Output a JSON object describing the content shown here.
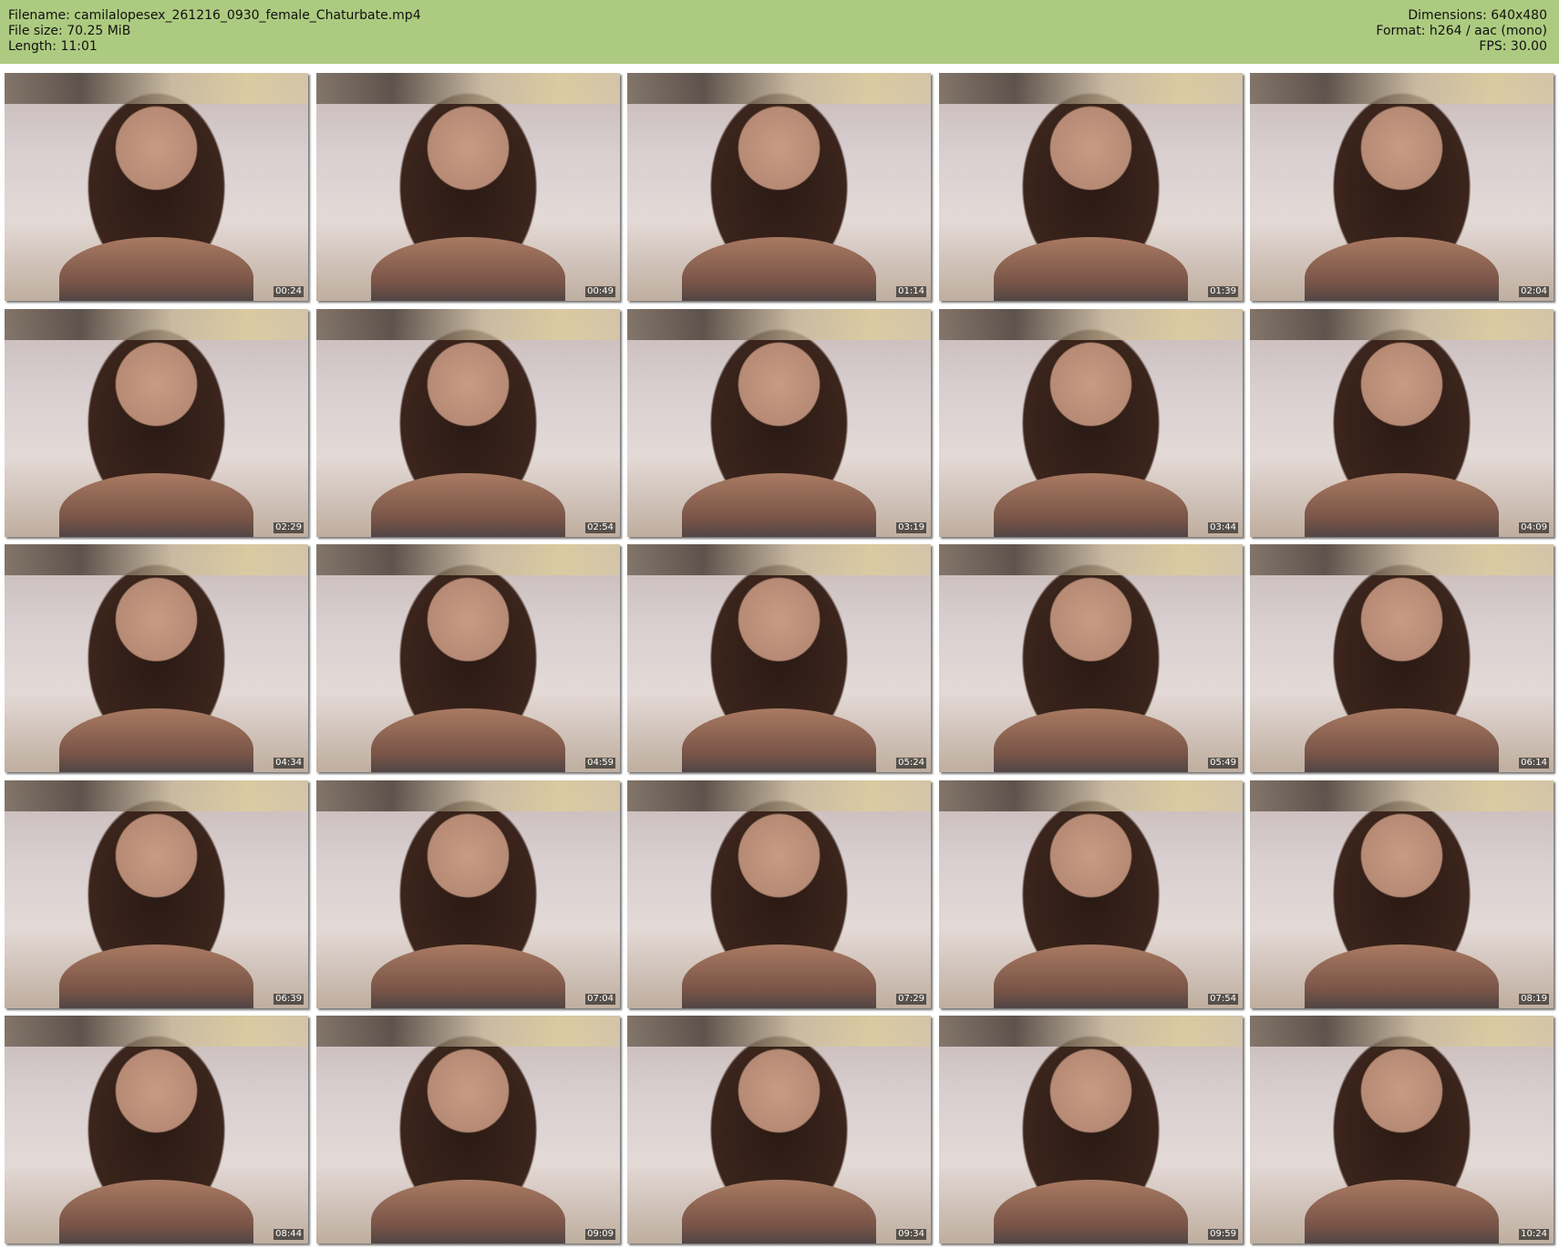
{
  "header": {
    "filename": "Filename: camilalopesex_261216_0930_female_Chaturbate.mp4",
    "filesize": "File size: 70.25 MiB",
    "length": "Length: 11:01",
    "dimensions": "Dimensions: 640x480",
    "format": "Format: h264 / aac (mono)",
    "fps": "FPS: 30.00"
  },
  "colors": {
    "header_bg": "#adcb80",
    "page_bg": "#ffffff"
  },
  "thumbnails": [
    {
      "timestamp": "00:24"
    },
    {
      "timestamp": "00:49"
    },
    {
      "timestamp": "01:14"
    },
    {
      "timestamp": "01:39"
    },
    {
      "timestamp": "02:04"
    },
    {
      "timestamp": "02:29"
    },
    {
      "timestamp": "02:54"
    },
    {
      "timestamp": "03:19"
    },
    {
      "timestamp": "03:44"
    },
    {
      "timestamp": "04:09"
    },
    {
      "timestamp": "04:34"
    },
    {
      "timestamp": "04:59"
    },
    {
      "timestamp": "05:24"
    },
    {
      "timestamp": "05:49"
    },
    {
      "timestamp": "06:14"
    },
    {
      "timestamp": "06:39"
    },
    {
      "timestamp": "07:04"
    },
    {
      "timestamp": "07:29"
    },
    {
      "timestamp": "07:54"
    },
    {
      "timestamp": "08:19"
    },
    {
      "timestamp": "08:44"
    },
    {
      "timestamp": "09:09"
    },
    {
      "timestamp": "09:34"
    },
    {
      "timestamp": "09:59"
    },
    {
      "timestamp": "10:24"
    }
  ]
}
